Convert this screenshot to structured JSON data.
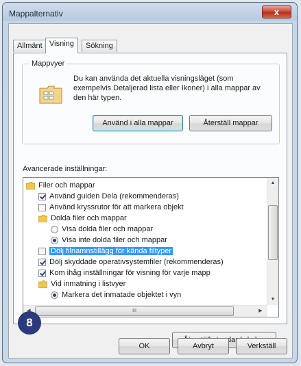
{
  "window": {
    "title": "Mappalternativ",
    "close_label": "x"
  },
  "tabs": [
    {
      "label": "Allmänt"
    },
    {
      "label": "Visning"
    },
    {
      "label": "Sökning"
    }
  ],
  "folder_views": {
    "group_title": "Mappvyer",
    "description": "Du kan använda det aktuella visningsläget (som exempelvis Detaljerad lista eller Ikoner) i alla mappar av den här typen.",
    "apply_button": "Använd i alla mappar",
    "reset_button": "Återställ mappar"
  },
  "advanced": {
    "label": "Avancerade inställningar:",
    "items": [
      {
        "type": "folder",
        "label": "Filer och mappar",
        "checked": false
      },
      {
        "type": "checkbox",
        "label": "Använd guiden Dela (rekommenderas)",
        "checked": true
      },
      {
        "type": "checkbox",
        "label": "Använd kryssrutor för att markera objekt",
        "checked": false
      },
      {
        "type": "folder",
        "label": "Dolda filer och mappar",
        "checked": false
      },
      {
        "type": "radio",
        "label": "Visa dolda filer och mappar",
        "checked": false
      },
      {
        "type": "radio",
        "label": "Visa inte dolda filer och mappar",
        "checked": true
      },
      {
        "type": "checkbox",
        "label": "Dölj filnamnstillägg för kända filtyper",
        "checked": false,
        "selected": true
      },
      {
        "type": "checkbox",
        "label": "Dölj skyddade operativsystemfiler (rekommenderas)",
        "checked": true
      },
      {
        "type": "checkbox",
        "label": "Kom ihåg inställningar för visning för varje mapp",
        "checked": true
      },
      {
        "type": "folder",
        "label": "Vid inmatning i listvyer",
        "checked": false
      },
      {
        "type": "radio",
        "label": "Markera det inmatade objektet i vyn",
        "checked": true
      }
    ],
    "hscroll_glyph": "III",
    "restore_defaults_button": "Återställ standardvärden"
  },
  "footer": {
    "ok": "OK",
    "cancel": "Avbryt",
    "apply": "Verkställ"
  },
  "step_badge": "8",
  "colors": {
    "selection": "#3399ff",
    "badge": "#2b3a7a",
    "close": "#c7432f"
  }
}
